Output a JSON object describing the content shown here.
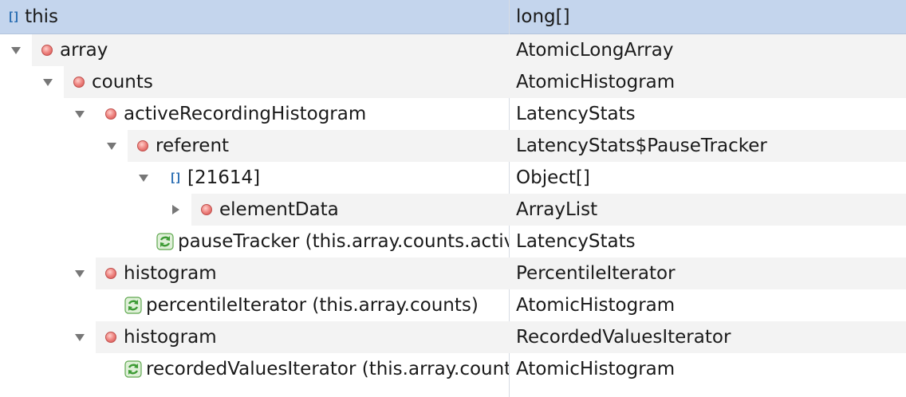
{
  "header": {
    "name": "this",
    "type": "long[]",
    "icon": "array-icon"
  },
  "rows": [
    {
      "label": "array",
      "type": "AtomicLongArray",
      "icon": "field-icon",
      "toggle": "expanded"
    },
    {
      "label": "counts",
      "type": "AtomicHistogram",
      "icon": "field-icon",
      "toggle": "expanded"
    },
    {
      "label": "activeRecordingHistogram",
      "type": "LatencyStats",
      "icon": "field-icon",
      "toggle": "expanded"
    },
    {
      "label": "referent",
      "type": "LatencyStats$PauseTracker",
      "icon": "field-icon",
      "toggle": "expanded"
    },
    {
      "label": "[21614]",
      "type": "Object[]",
      "icon": "array-icon",
      "toggle": "expanded"
    },
    {
      "label": "elementData",
      "type": "ArrayList",
      "icon": "field-icon",
      "toggle": "collapsed"
    },
    {
      "label": "pauseTracker (this.array.counts.activeRecordingHistogram)",
      "type": "LatencyStats",
      "icon": "cycle-icon",
      "toggle": "none"
    },
    {
      "label": "histogram",
      "type": "PercentileIterator",
      "icon": "field-icon",
      "toggle": "expanded"
    },
    {
      "label": "percentileIterator (this.array.counts)",
      "type": "AtomicHistogram",
      "icon": "cycle-icon",
      "toggle": "none"
    },
    {
      "label": "histogram",
      "type": "RecordedValuesIterator",
      "icon": "field-icon",
      "toggle": "expanded"
    },
    {
      "label": "recordedValuesIterator (this.array.counts)",
      "type": "AtomicHistogram",
      "icon": "cycle-icon",
      "toggle": "none"
    }
  ],
  "colors": {
    "header_bg": "#c4d5ed",
    "stripe": "#f3f3f3",
    "field_dot": "#e06666",
    "array_icon": "#2c6fb3",
    "cycle_icon": "#4caf50"
  }
}
